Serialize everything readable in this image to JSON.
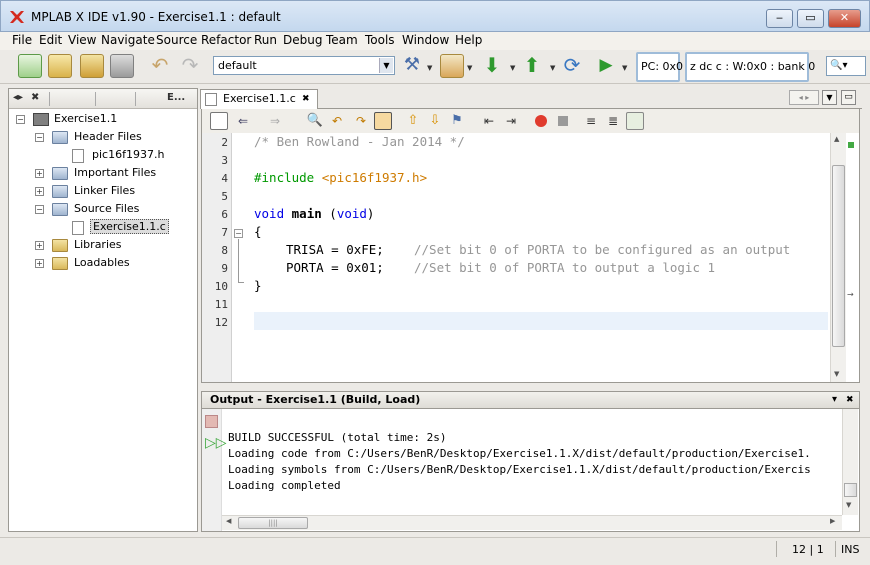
{
  "window": {
    "title": "MPLAB X IDE v1.90 - Exercise1.1 : default"
  },
  "menu": [
    "File",
    "Edit",
    "View",
    "Navigate",
    "Source",
    "Refactor",
    "Run",
    "Debug",
    "Team",
    "Tools",
    "Window",
    "Help"
  ],
  "toolbar": {
    "config": "default",
    "pc": "PC: 0x0",
    "status_reg": "z dc c  : W:0x0 : bank 0",
    "search_icon": "search-icon"
  },
  "left_panel": {
    "tabs": [
      "E..."
    ],
    "tree": {
      "project": "Exercise1.1",
      "header_files": "Header Files",
      "header_file": "pic16f1937.h",
      "important_files": "Important Files",
      "linker_files": "Linker Files",
      "source_files": "Source Files",
      "source_file": "Exercise1.1.c",
      "libraries": "Libraries",
      "loadables": "Loadables"
    }
  },
  "editor": {
    "tab_label": "Exercise1.1.c",
    "line_numbers": [
      "2",
      "3",
      "4",
      "5",
      "6",
      "7",
      "8",
      "9",
      "10",
      "11",
      "12"
    ],
    "code": {
      "l2": "/* Ben Rowland - Jan 2014 */",
      "l4_directive": "#include",
      "l4_file": "<pic16f1937.h>",
      "l6_void": "void",
      "l6_main": "main",
      "l6_paren_open": "(",
      "l6_void2": "void",
      "l6_paren_close": ")",
      "l7": "{",
      "l8_code": "TRISA = 0xFE;",
      "l8_comment": "//Set bit 0 of PORTA to be configured as an output",
      "l9_code": "PORTA = 0x01;",
      "l9_comment": "//Set bit 0 of PORTA to output a logic 1",
      "l10": "}"
    }
  },
  "output": {
    "title": "Output - Exercise1.1 (Build, Load)",
    "lines": [
      "BUILD SUCCESSFUL (total time: 2s)",
      "Loading code from C:/Users/BenR/Desktop/Exercise1.1.X/dist/default/production/Exercise1.",
      "Loading symbols from C:/Users/BenR/Desktop/Exercise1.1.X/dist/default/production/Exercis",
      "Loading completed"
    ]
  },
  "status": {
    "position": "12 | 1",
    "mode": "INS"
  }
}
